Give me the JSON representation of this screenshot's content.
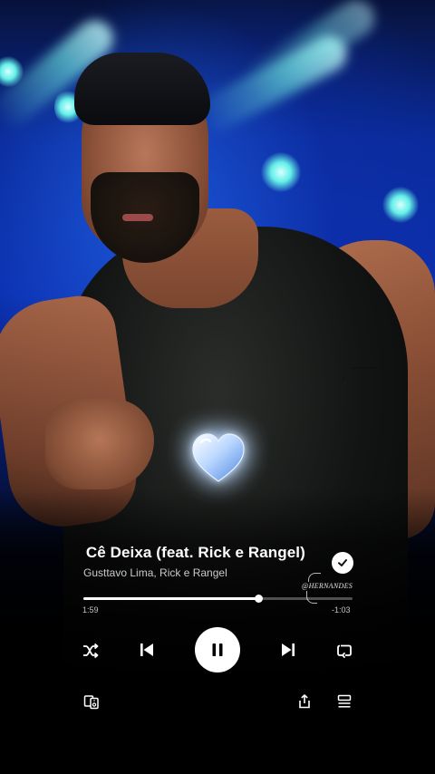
{
  "player": {
    "track_title": "Que Cê Deixa (feat. Rick e Rangel)",
    "track_title_visible": "ue Cê Deixa (feat. Rick e Rangel)",
    "artists": "Gusttavo Lima, Rick e Rangel",
    "saved": true,
    "time_elapsed": "1:59",
    "time_remaining": "-1:03",
    "progress": 0.65,
    "is_playing": true
  },
  "overlay": {
    "watermark": "@HERNANDES",
    "sticker": "blue-heart"
  },
  "icons": {
    "shuffle": "shuffle-icon",
    "previous": "skip-previous-icon",
    "play_pause": "pause-icon",
    "next": "skip-next-icon",
    "repeat": "repeat-icon",
    "devices": "connect-device-icon",
    "share": "share-icon",
    "queue": "queue-icon",
    "saved": "check-icon"
  },
  "colors": {
    "stage_blue": "#0b2fb0",
    "beam_cyan": "#64f0e8",
    "accent_white": "#ffffff",
    "background": "#000000"
  }
}
